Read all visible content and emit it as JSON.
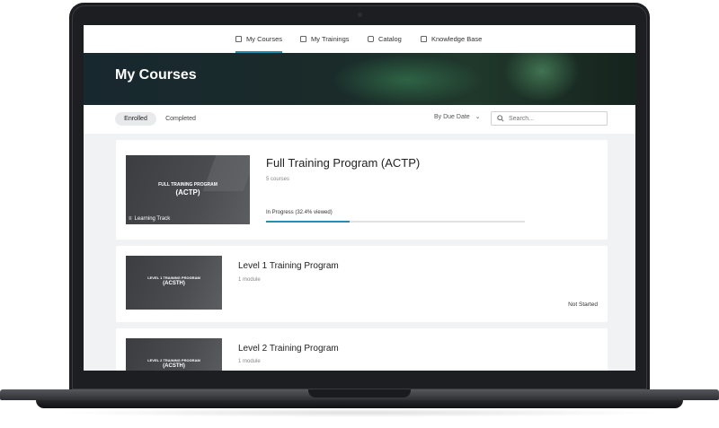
{
  "nav": {
    "items": [
      {
        "label": "My Courses",
        "icon": "book-icon",
        "active": true
      },
      {
        "label": "My Trainings",
        "icon": "calendar-icon",
        "active": false
      },
      {
        "label": "Catalog",
        "icon": "bag-icon",
        "active": false
      },
      {
        "label": "Knowledge Base",
        "icon": "document-icon",
        "active": false
      }
    ]
  },
  "hero": {
    "title": "My Courses"
  },
  "tabs": [
    {
      "label": "Enrolled",
      "active": true
    },
    {
      "label": "Completed",
      "active": false
    }
  ],
  "sort": {
    "label": "By Due Date"
  },
  "search": {
    "placeholder": "Search..."
  },
  "courses": [
    {
      "thumb_line1": "FULL TRAINING PROGRAM",
      "thumb_line2": "(ACTP)",
      "badge": "Learning Track",
      "title": "Full Training Program (ACTP)",
      "subtitle": "5 courses",
      "progress_label": "In Progress (32.4% viewed)",
      "progress": 0.324
    },
    {
      "thumb_line1": "LEVEL 1 TRAINING PROGRAM",
      "thumb_line2": "(ACSTH)",
      "title": "Level 1 Training Program",
      "subtitle": "1 module",
      "status": "Not Started"
    },
    {
      "thumb_line1": "LEVEL 2 TRAINING PROGRAM",
      "thumb_line2": "(ACSTH)",
      "title": "Level 2 Training Program",
      "subtitle": "1 module"
    }
  ],
  "colors": {
    "accent": "#1f8fb5",
    "hero_dark": "#18282f",
    "laptop": "#1d1e21"
  }
}
